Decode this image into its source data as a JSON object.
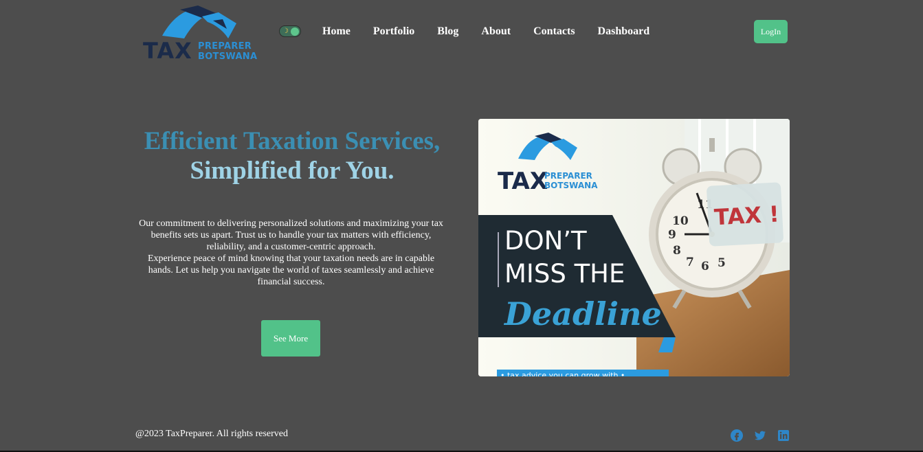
{
  "header": {
    "logo_word": "TAX",
    "logo_sub1": "PREPARER",
    "logo_sub2": "BOTSWANA",
    "theme_toggle_icon": "moon-icon",
    "nav": [
      "Home",
      "Portfolio",
      "Blog",
      "About",
      "Contacts",
      "Dashboard"
    ],
    "login_label": "LogIn"
  },
  "hero": {
    "title_line1": "Efficient Taxation Services,",
    "title_line2": "Simplified for You.",
    "paragraph1": "Our commitment to delivering personalized solutions and maximizing your tax benefits sets us apart. Trust us to handle your tax matters with efficiency, reliability, and a customer-centric approach.",
    "paragraph2": "Experience peace of mind knowing that your taxation needs are in capable hands. Let us help you navigate the world of taxes seamlessly and achieve financial success.",
    "cta_label": "See More"
  },
  "poster": {
    "logo_word": "TAX",
    "logo_sub1": "PREPARER",
    "logo_sub2": "BOTSWANA",
    "line1": "DON’T",
    "line2": "MISS THE",
    "line3": "Deadline",
    "note": "TAX !",
    "clock_numbers": [
      "11",
      "10",
      "9",
      "8",
      "7",
      "6",
      "5"
    ],
    "bottom_banner": "• tax advice you can grow with •"
  },
  "footer": {
    "copyright": "@2023 TaxPreparer. All rights reserved",
    "social": [
      "facebook-icon",
      "twitter-icon",
      "linkedin-icon"
    ]
  },
  "colors": {
    "background": "#4d4d4d",
    "accent_green": "#52c289",
    "title_blue": "#3b8fb3",
    "title_light": "#9fd3e6",
    "social_blue": "#2e86c8"
  }
}
